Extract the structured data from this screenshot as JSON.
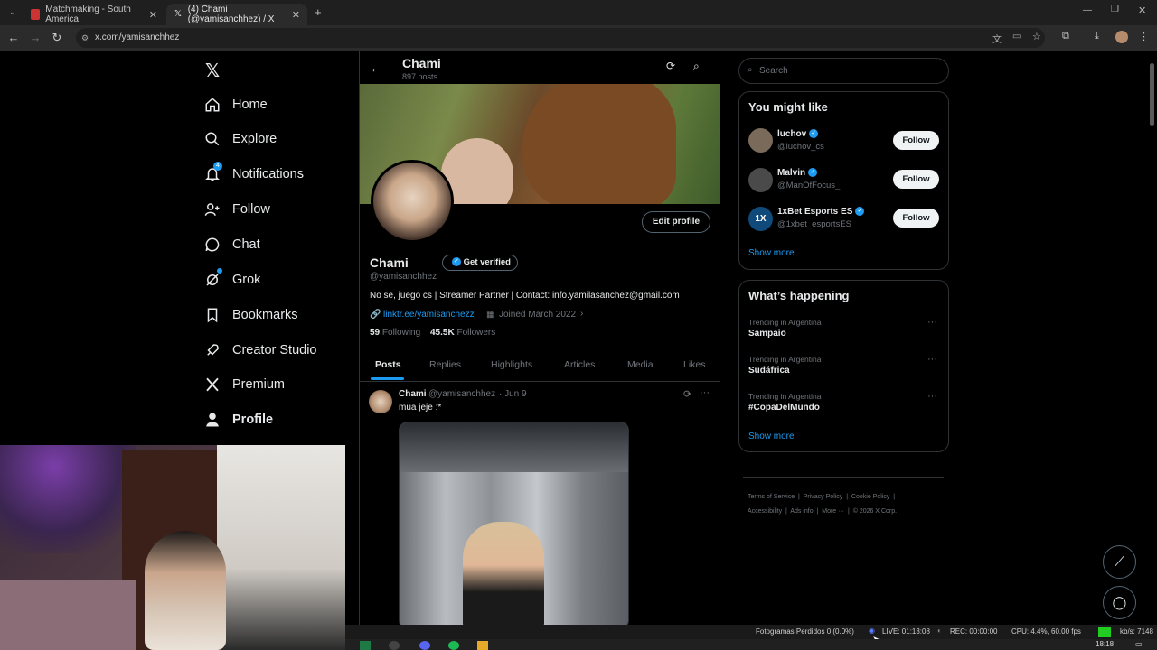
{
  "browser": {
    "tabs": [
      {
        "label": "Matchmaking - South America"
      },
      {
        "label": "(4) Chami (@yamisanchhez) / X"
      }
    ],
    "url": "x.com/yamisanchhez"
  },
  "sidebar": {
    "items": [
      {
        "label": "Home"
      },
      {
        "label": "Explore"
      },
      {
        "label": "Notifications",
        "badge": "4"
      },
      {
        "label": "Follow"
      },
      {
        "label": "Chat"
      },
      {
        "label": "Grok"
      },
      {
        "label": "Bookmarks"
      },
      {
        "label": "Creator Studio"
      },
      {
        "label": "Premium"
      },
      {
        "label": "Profile"
      }
    ]
  },
  "header": {
    "name": "Chami",
    "posts": "897 posts"
  },
  "profile": {
    "edit_label": "Edit profile",
    "name": "Chami",
    "get_verified": "Get verified",
    "handle": "@yamisanchhez",
    "bio": "No se, juego cs | Streamer Partner | Contact: info.yamilasanchez@gmail.com",
    "link": "linktr.ee/yamisanchezz",
    "joined": "Joined March 2022",
    "following_count": "59",
    "following_label": "Following",
    "followers_count": "45.5K",
    "followers_label": "Followers"
  },
  "tabs": [
    "Posts",
    "Replies",
    "Highlights",
    "Articles",
    "Media",
    "Likes"
  ],
  "post": {
    "name": "Chami",
    "handle": "@yamisanchhez",
    "date": "· Jun 9",
    "text": "mua jeje :*"
  },
  "right": {
    "search_placeholder": "Search",
    "suggest_title": "You might like",
    "suggestions": [
      {
        "name": "luchov",
        "handle": "@luchov_cs",
        "button": "Follow"
      },
      {
        "name": "Malvin",
        "handle": "@ManOfFocus_",
        "button": "Follow"
      },
      {
        "name": "1xBet Esports ES",
        "handle": "@1xbet_esportsES",
        "button": "Follow"
      }
    ],
    "show_more": "Show more",
    "happening_title": "What’s happening",
    "trends": [
      {
        "context": "Trending in Argentina",
        "topic": "Sampaio"
      },
      {
        "context": "Trending in Argentina",
        "topic": "Sudáfrica"
      },
      {
        "context": "Trending in Argentina",
        "topic": "#CopaDelMundo"
      }
    ],
    "show_more_2": "Show more",
    "footer": {
      "line1": [
        "Terms of Service",
        "Privacy Policy",
        "Cookie Policy"
      ],
      "line2": [
        "Accessibility",
        "Ads info",
        "More ···",
        "© 2026 X Corp."
      ]
    }
  },
  "obs": {
    "dropped": "Fotogramas Perdidos 0 (0.0%)",
    "live": "LIVE: 01:13:08",
    "rec": "REC: 00:00:00",
    "cpu": "CPU: 4.4%, 60.00 fps",
    "kbs": "kb/s: 7148"
  },
  "clock": "18:18",
  "colors": {
    "accent": "#1d9bf0",
    "background": "#000000",
    "border": "#2f3336"
  }
}
